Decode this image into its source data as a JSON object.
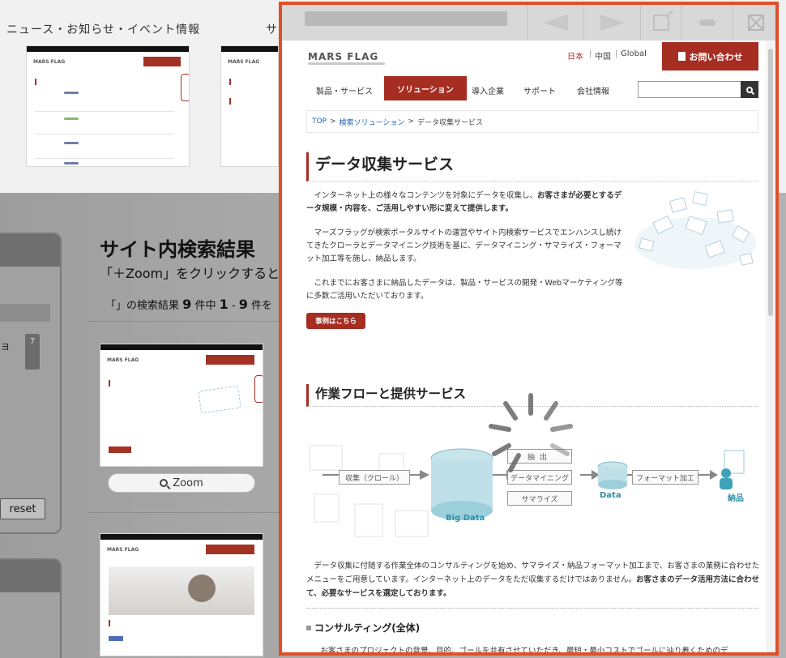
{
  "background": {
    "heading_news": "ニュース・お知らせ・イベント情報",
    "heading_site_partial": "サ",
    "search_title": "サイト内検索結果",
    "zoom_hint": "「＋Zoom」をクリックすると",
    "result_count": {
      "prefix": "「」の検索結果",
      "total": "9",
      "unit_total": "件中",
      "range_start": "1",
      "range_sep": "-",
      "range_end": "9",
      "unit_range": "件を"
    },
    "zoom_button": "Zoom",
    "reset_button": "reset",
    "side_chip": "7",
    "side_kana": "ョ"
  },
  "overlay": {
    "site": {
      "logo": "MARS FLAG",
      "languages": [
        "日本",
        "中国",
        "Global"
      ],
      "contact_button": "お問い合わせ",
      "nav": [
        "製品・サービス",
        "ソリューション",
        "導入企業",
        "サポート",
        "会社情報"
      ],
      "breadcrumb": {
        "top": "TOP",
        "sep": ">",
        "mid": "検索ソリューション",
        "current": "データ収集サービス"
      },
      "h1": "データ収集サービス",
      "p1_normal": "　インターネット上の様々なコンテンツを対象にデータを収集し、",
      "p1_bold": "お客さまが必要とするデータ規模・内容を、ご活用しやすい形に変えて提供します。",
      "p2": "　マーズフラッグが検索ポータルサイトの運営やサイト内検索サービスでエンハンスし続けてきたクローラとデータマイニング技術を基に、データマイニング・サマライズ・フォーマット加工等を施し、納品します。",
      "p3": "　これまでにお客さまに納品したデータは、製品・サービスの開発・Webマーケティング等に多数ご活用いただいております。",
      "case_button": "事例はこちら",
      "h2": "作業フローと提供サービス",
      "flow": {
        "collect": "収集（クロール）",
        "bigdata": "Big Data",
        "extract": "抽出",
        "mining": "データマイニング",
        "summarize": "サマライズ",
        "data": "Data",
        "format": "フォーマット加工",
        "deliver": "納品"
      },
      "p4_normal": "　データ収集に付随する作業全体のコンサルティングを始め、サマライズ・納品フォーマット加工まで、お客さまの業務に合わせたメニューをご用意しています。インターネット上のデータをただ収集するだけではありません。",
      "p4_bold": "お客さまのデータ活用方法に合わせて、必要なサービスを選定しております。",
      "h3": "コンサルティング(全体)",
      "p5": "　お客さまのプロジェクトの背景、目的、ゴールを共有させていただき、最短・最小コストでゴールに辿り着くためのデ"
    }
  },
  "colors": {
    "accent": "#a52d22",
    "overlay_border": "#e04f27",
    "teal": "#2e8fa7"
  }
}
